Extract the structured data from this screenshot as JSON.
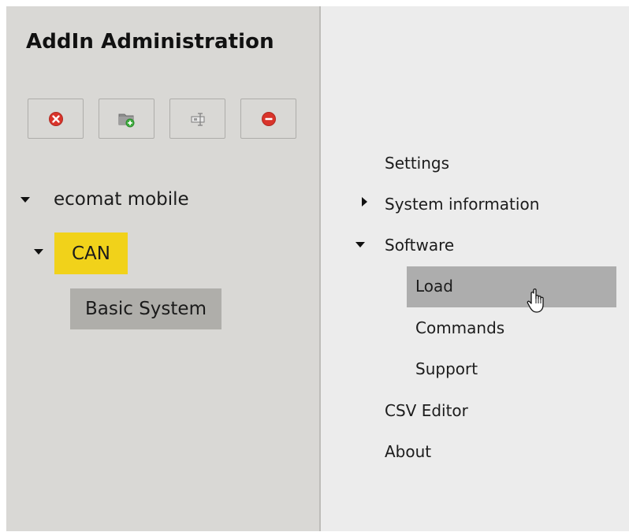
{
  "left_panel": {
    "title": "AddIn Administration",
    "toolbar": {
      "buttons": [
        {
          "name": "close",
          "icon": "red-x-circle-icon",
          "color": "#d9342b"
        },
        {
          "name": "add-folder",
          "icon": "folder-add-icon",
          "color": "#3fae3f"
        },
        {
          "name": "configure",
          "icon": "module-icon",
          "color": "#8a8a8a"
        },
        {
          "name": "remove",
          "icon": "red-minus-circle-icon",
          "color": "#d9342b"
        }
      ]
    },
    "tree": {
      "root": {
        "label": "ecomat mobile",
        "expanded": true
      },
      "child": {
        "label": "CAN",
        "expanded": true,
        "highlight_color": "#f1d21a"
      },
      "leaf": {
        "label": "Basic System",
        "selected": true
      }
    }
  },
  "right_panel": {
    "menu": {
      "settings": "Settings",
      "system_information": "System information",
      "software": "Software",
      "load": "Load",
      "commands": "Commands",
      "support": "Support",
      "csv_editor": "CSV Editor",
      "about": "About"
    },
    "hovered_item": "Load",
    "cursor": "hand-pointer-icon"
  },
  "colors": {
    "left_background": "#d9d8d5",
    "right_background": "#ececec",
    "selection_gray": "#afaeaa",
    "yellow_highlight": "#f1d21a"
  }
}
